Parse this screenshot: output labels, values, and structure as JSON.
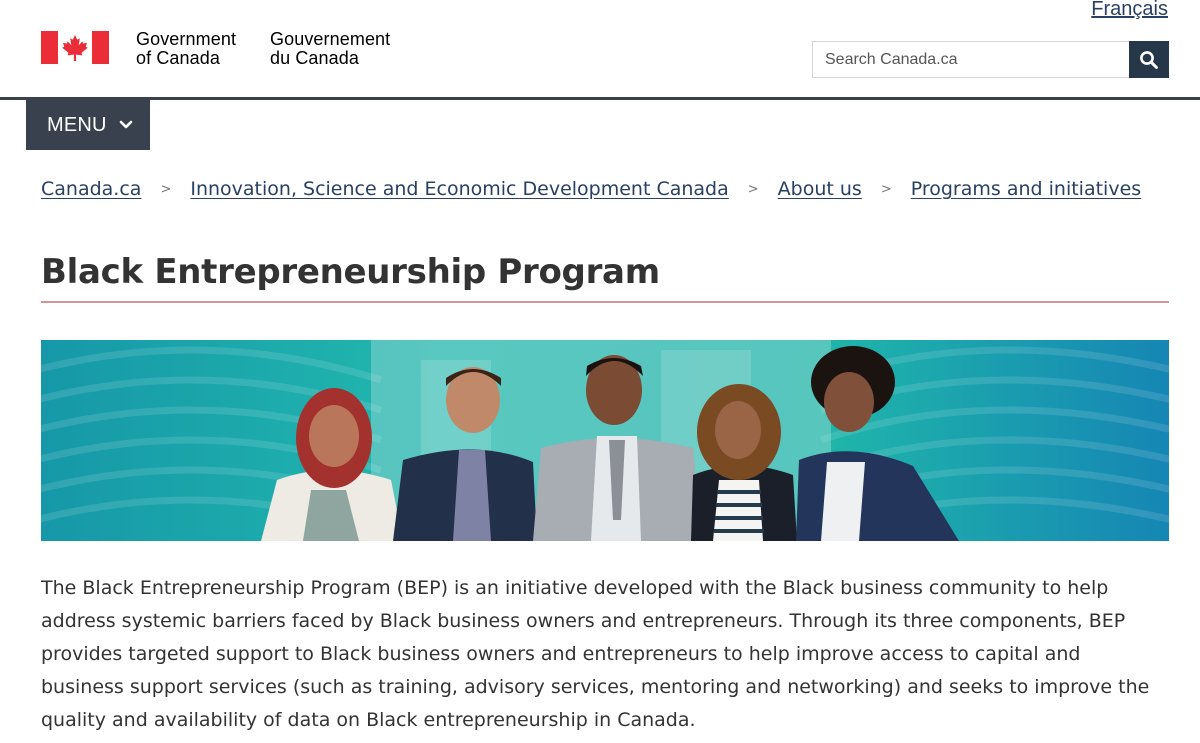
{
  "header": {
    "language_toggle": "Français",
    "fip_en_line1": "Government",
    "fip_en_line2": "of Canada",
    "fip_fr_line1": "Gouvernement",
    "fip_fr_line2": "du Canada",
    "search_placeholder": "Search Canada.ca",
    "search_icon": "search-icon"
  },
  "menu": {
    "label": "MENU",
    "icon": "chevron-down-icon"
  },
  "breadcrumb": {
    "items": [
      "Canada.ca",
      "Innovation, Science and Economic Development Canada",
      "About us",
      "Programs and initiatives"
    ],
    "separator": ">"
  },
  "main": {
    "title": "Black Entrepreneurship Program",
    "intro": "The Black Entrepreneurship Program (BEP) is an initiative developed with the Black business community to help address systemic barriers faced by Black business owners and entrepreneurs. Through its three components, BEP provides targeted support to Black business owners and entrepreneurs to help improve access to capital and business support services (such as training, advisory services, mentoring and networking) and seeks to improve the quality and availability of data on Black entrepreneurship in Canada."
  },
  "colors": {
    "flag_red": "#eb2d37",
    "link": "#284162",
    "header_rule": "#38414d",
    "search_button": "#26374a",
    "title_rule": "#af3c43",
    "banner_teal": "#1fb5aa",
    "banner_blue": "#1a8fb8"
  }
}
